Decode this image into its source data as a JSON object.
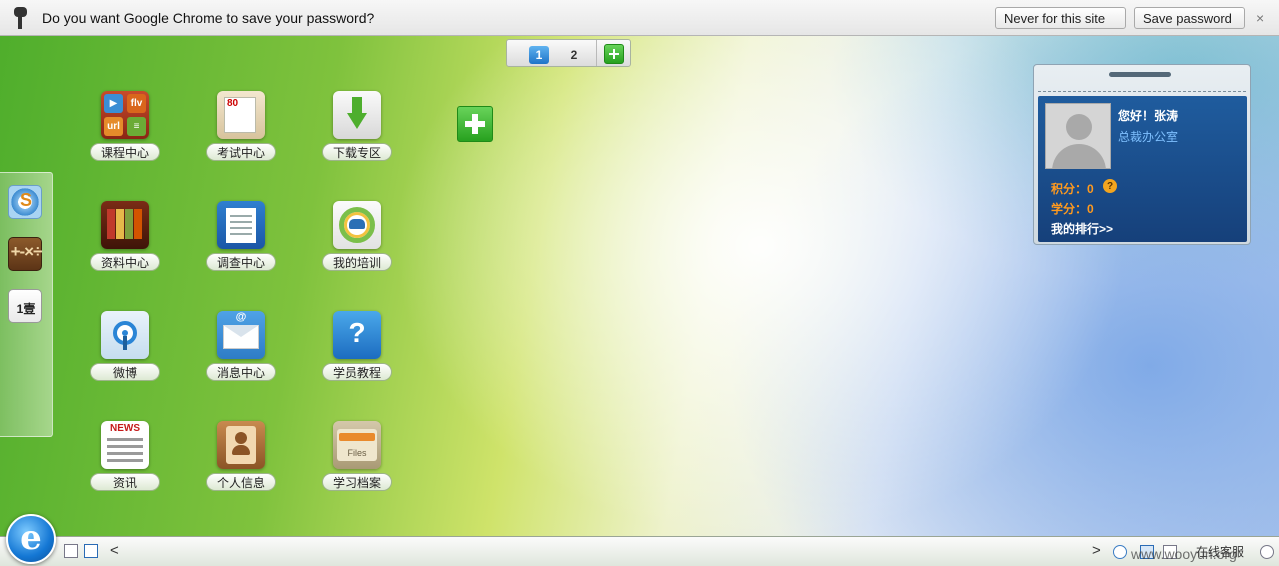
{
  "infobar": {
    "message": "Do you want Google Chrome to save your password?",
    "never_label": "Never for this site",
    "save_label": "Save password",
    "close_label": "×"
  },
  "pager": {
    "pages": [
      "1",
      "2"
    ],
    "current": "1"
  },
  "apps": [
    {
      "label": "课程中心",
      "icon": "course-center-icon"
    },
    {
      "label": "考试中心",
      "icon": "exam-center-icon"
    },
    {
      "label": "下载专区",
      "icon": "download-area-icon"
    },
    {
      "label": "资料中心",
      "icon": "materials-center-icon"
    },
    {
      "label": "调查中心",
      "icon": "survey-center-icon"
    },
    {
      "label": "我的培训",
      "icon": "my-training-icon"
    },
    {
      "label": "微博",
      "icon": "weibo-icon"
    },
    {
      "label": "消息中心",
      "icon": "message-center-icon"
    },
    {
      "label": "学员教程",
      "icon": "student-tutorial-icon"
    },
    {
      "label": "资讯",
      "icon": "news-icon"
    },
    {
      "label": "个人信息",
      "icon": "personal-info-icon"
    },
    {
      "label": "学习档案",
      "icon": "learning-files-icon"
    }
  ],
  "icon_text": {
    "course_flv": "flv",
    "course_url": "url",
    "exam_score": "80",
    "msg_at": "@",
    "help_mark": "?",
    "news_head": "NEWS",
    "files_label": "Files",
    "dock_s": "S",
    "dock_calc": "+-×÷",
    "dock_cal": "1壹"
  },
  "user": {
    "greeting": "您好！张涛",
    "department": "总裁办公室",
    "points_label": "积分：",
    "points_value": "0",
    "credits_label": "学分：",
    "credits_value": "0",
    "rank_link": "我的排行>>",
    "help_mark": "?"
  },
  "taskbar": {
    "start_glyph": "e",
    "left_arrow": "<",
    "right_arrow": ">",
    "online_service": "在线客服",
    "watermark": "www.wooyun.org"
  },
  "colors": {
    "accent_blue": "#1f5c9e",
    "score_orange": "#ff9a1e",
    "add_green": "#27a11f"
  }
}
